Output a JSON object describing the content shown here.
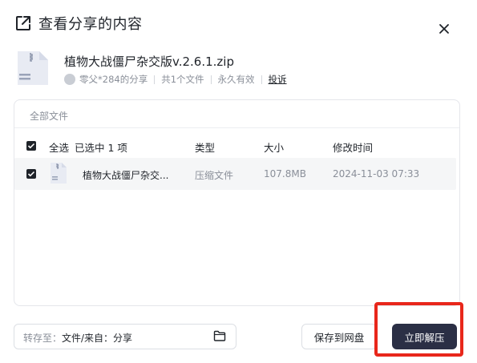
{
  "dialog": {
    "title": "查看分享的内容"
  },
  "file": {
    "name": "植物大战僵尸杂交版v.2.6.1.zip",
    "sharer": "零父*284的分享",
    "count": "共1个文件",
    "validity": "永久有效",
    "report": "投诉"
  },
  "panel": {
    "heading": "全部文件"
  },
  "table": {
    "select_all": "全选",
    "selected": "已选中 1 项",
    "columns": {
      "type": "类型",
      "size": "大小",
      "modified": "修改时间"
    },
    "rows": [
      {
        "name": "植物大战僵尸杂交...",
        "type": "压缩文件",
        "size": "107.8MB",
        "modified": "2024-11-03 07:33",
        "checked": true
      }
    ]
  },
  "footer": {
    "save_to_label": "转存至：",
    "save_to_path": "文件/来自：分享",
    "save_button": "保存到网盘",
    "extract_button": "立即解压"
  },
  "colors": {
    "primary_button": "#2b2f45",
    "highlight": "#e8271b"
  },
  "icons": [
    "share-external-icon",
    "close-icon",
    "zip-file-icon",
    "avatar",
    "checkbox-checked-icon",
    "folder-icon"
  ]
}
